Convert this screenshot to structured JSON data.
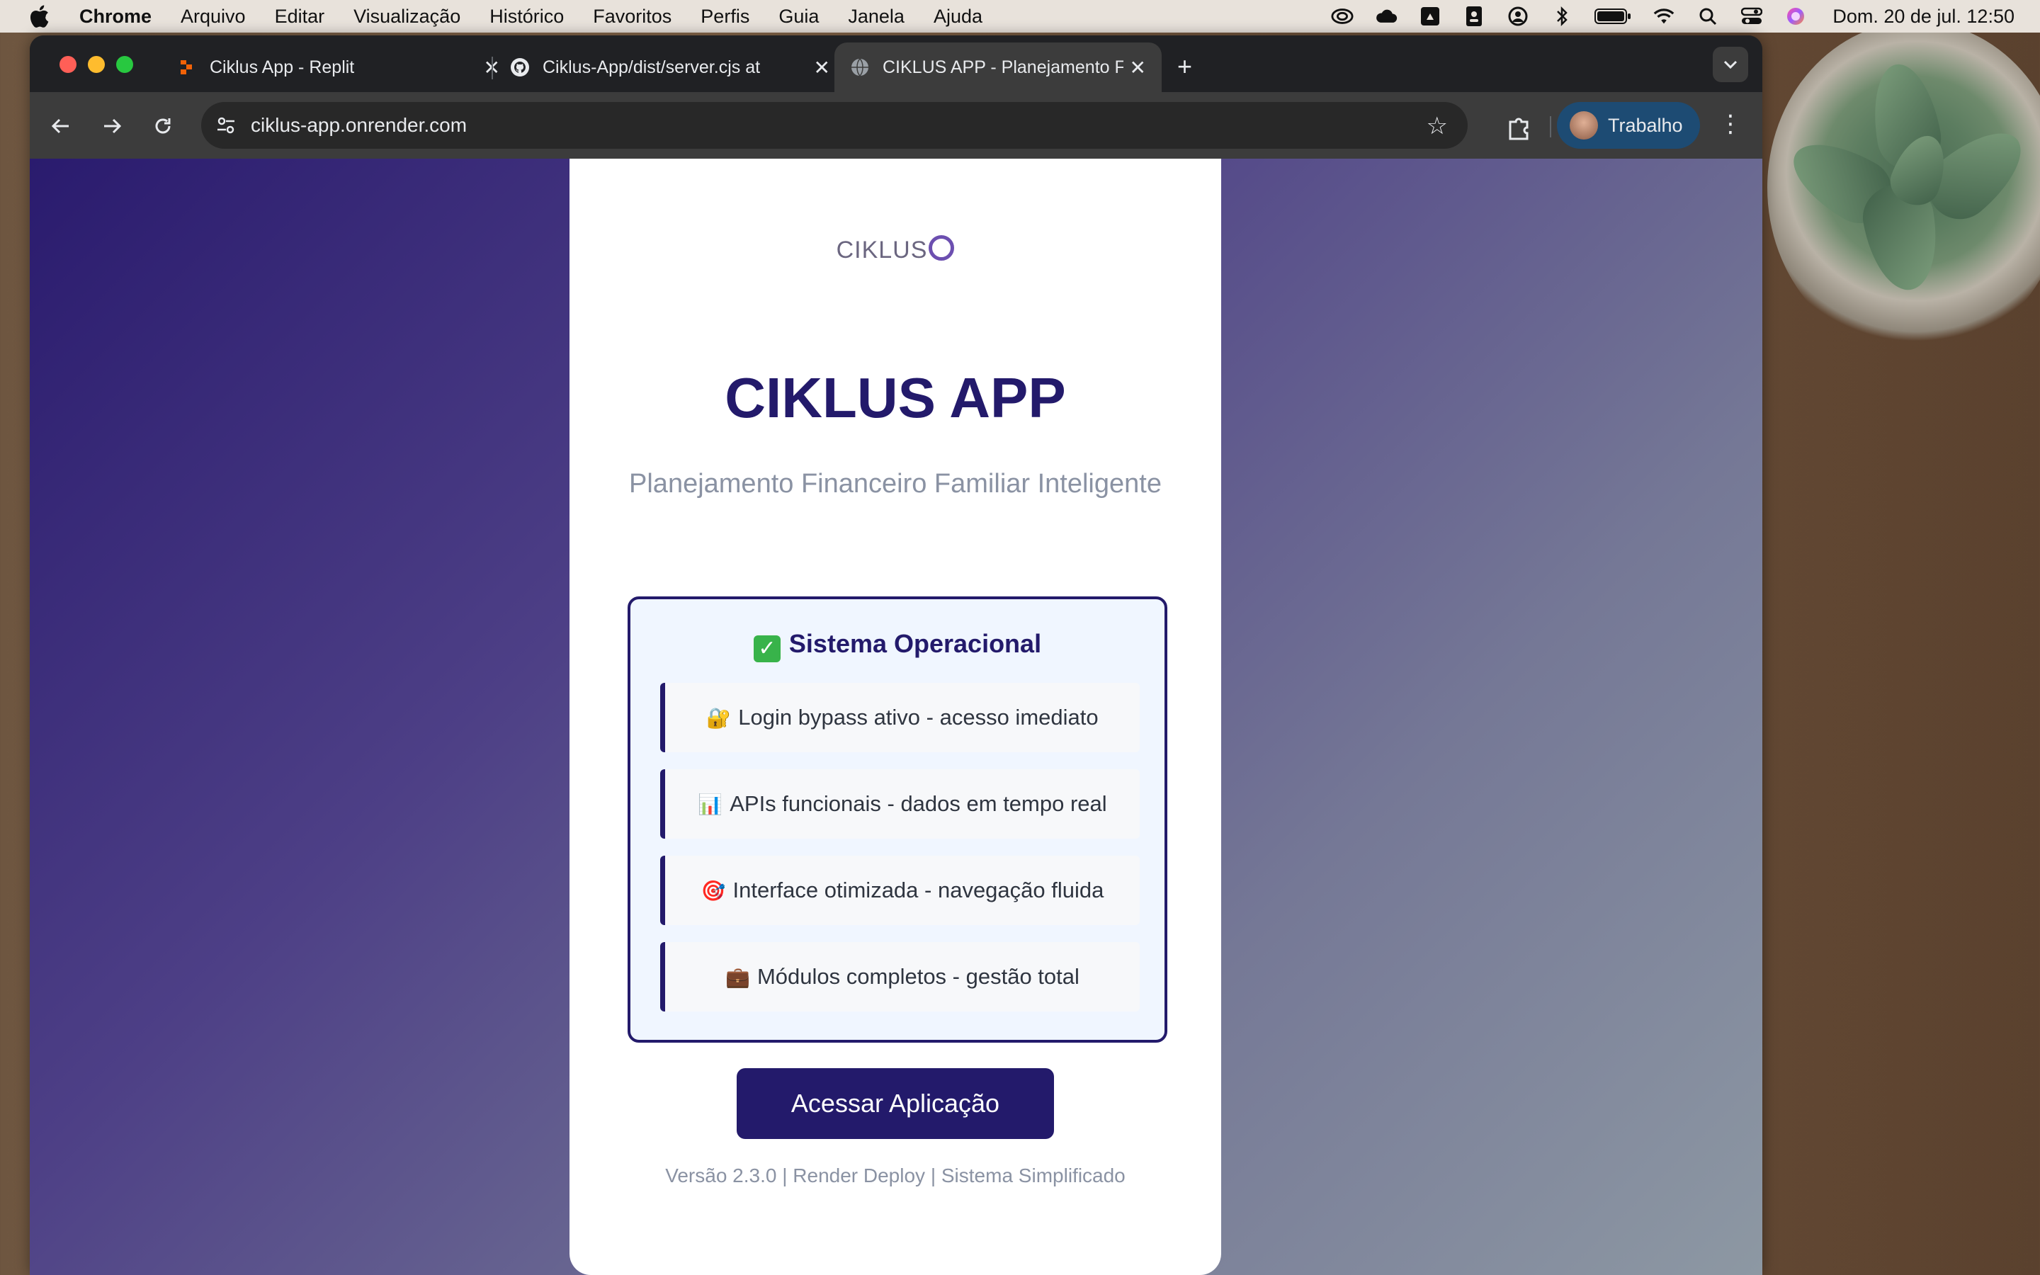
{
  "menubar": {
    "app": "Chrome",
    "items": [
      "Arquivo",
      "Editar",
      "Visualização",
      "Histórico",
      "Favoritos",
      "Perfis",
      "Guia",
      "Janela",
      "Ajuda"
    ],
    "status_icons": [
      "creative-cloud-icon",
      "cloud-icon",
      "drive-icon",
      "contacts-icon",
      "user-circle-icon",
      "bluetooth-icon",
      "battery-icon",
      "wifi-icon",
      "search-icon",
      "control-center-icon",
      "siri-icon"
    ],
    "clock": "Dom. 20 de jul.  12:50"
  },
  "tabs": [
    {
      "title": "Ciklus App - Replit",
      "icon": "replit-icon",
      "active": false
    },
    {
      "title": "Ciklus-App/dist/server.cjs at",
      "icon": "github-icon",
      "active": false
    },
    {
      "title": "CIKLUS APP - Planejamento F",
      "icon": "globe-icon",
      "active": true
    }
  ],
  "toolbar": {
    "url": "ciklus-app.onrender.com",
    "profile_label": "Trabalho"
  },
  "page": {
    "logo_text": "CIKLUS",
    "title": "CIKLUS APP",
    "subtitle": "Planejamento Financeiro Familiar Inteligente",
    "status_heading": "Sistema Operacional",
    "features": [
      {
        "emoji": "🔐",
        "text": "Login bypass ativo - acesso imediato"
      },
      {
        "emoji": "📊",
        "text": "APIs funcionais - dados em tempo real"
      },
      {
        "emoji": "🎯",
        "text": "Interface otimizada - navegação fluida"
      },
      {
        "emoji": "💼",
        "text": "Módulos completos - gestão total"
      }
    ],
    "cta_label": "Acessar Aplicação",
    "footer": "Versão 2.3.0 | Render Deploy | Sistema Simplificado"
  },
  "colors": {
    "brand": "#231a6b",
    "box_bg": "#f0f6ff",
    "muted_text": "#8a92a3",
    "check_green": "#38b34a"
  }
}
